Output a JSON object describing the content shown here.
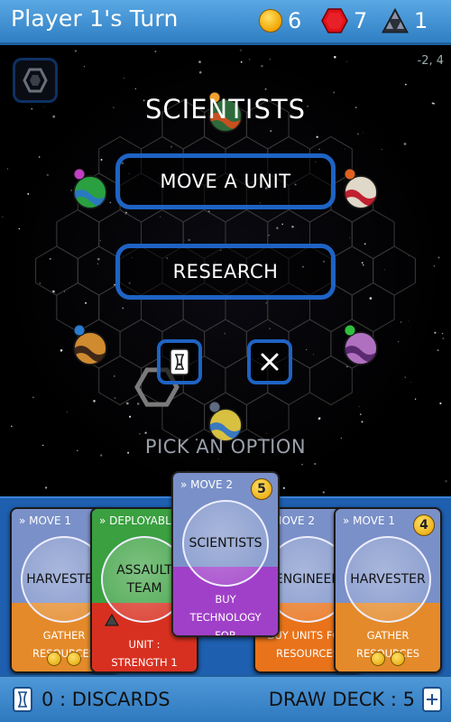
{
  "header": {
    "title": "Player 1's Turn",
    "resources": [
      {
        "icon": "gold-coin-icon",
        "value": "6"
      },
      {
        "icon": "red-hexagon-icon",
        "value": "7"
      },
      {
        "icon": "triangle-stack-icon",
        "value": "1"
      }
    ]
  },
  "board": {
    "coords": "-2, 4",
    "menu_icon": "hex-menu-icon",
    "planets": [
      {
        "name": "planet-top",
        "flag": "#f0a030",
        "body": "#2e6a3a",
        "band": "#c85020"
      },
      {
        "name": "planet-left-upper",
        "flag": "#c040c0",
        "body": "#2aa040",
        "band": "#2a78c0"
      },
      {
        "name": "planet-right-upper",
        "flag": "#e06020",
        "body": "#e0d8c8",
        "band": "#c02030"
      },
      {
        "name": "planet-left-lower",
        "flag": "#2a7ad0",
        "body": "#d08a30",
        "band": "#402818"
      },
      {
        "name": "planet-right-lower",
        "flag": "#30c040",
        "body": "#b070c0",
        "band": "#5a2a70"
      },
      {
        "name": "planet-bottom",
        "flag": "#606a80",
        "body": "#d8c040",
        "band": "#3a78c0"
      }
    ]
  },
  "dialog": {
    "title": "SCIENTISTS",
    "option_move": "MOVE A UNIT",
    "option_research": "RESEARCH",
    "discard_icon": "discard-card-icon",
    "close_icon": "close-icon",
    "prompt": "PICK AN OPTION"
  },
  "hand": {
    "cards": [
      {
        "type": "MOVE 1",
        "name": "HARVESTER",
        "effect": "GATHER RESOURCES",
        "cost": "",
        "coins": 2,
        "top": "#7a90c8",
        "bottom": "#e48a2a"
      },
      {
        "type": "DEPLOYABLE",
        "name": "ASSAULT TEAM",
        "effect": "UNIT : STRENGTH 1",
        "cost": "",
        "coins": 0,
        "top": "#3aa040",
        "bottom": "#d83020"
      },
      {
        "type": "MOVE 2",
        "name": "ENGINEER",
        "effect": "BUY UNITS FOR RESOURCES",
        "cost": "",
        "coins": 0,
        "top": "#7a90c8",
        "bottom": "#e8731a"
      },
      {
        "type": "MOVE 1",
        "name": "HARVESTER",
        "effect": "GATHER RESOURCES",
        "cost": "4",
        "coins": 2,
        "top": "#7a90c8",
        "bottom": "#e48a2a"
      },
      {
        "type": "MOVE 2",
        "name": "SCIENTISTS",
        "effect": "BUY TECHNOLOGY FOR RESOURCES",
        "cost": "5",
        "coins": 0,
        "top": "#7a90c8",
        "bottom": "#a040c8"
      }
    ]
  },
  "footer": {
    "discards": "0 : DISCARDS",
    "draw_deck": "DRAW DECK : 5",
    "discard_icon": "discard-pile-icon",
    "deck_icon": "draw-deck-icon"
  }
}
